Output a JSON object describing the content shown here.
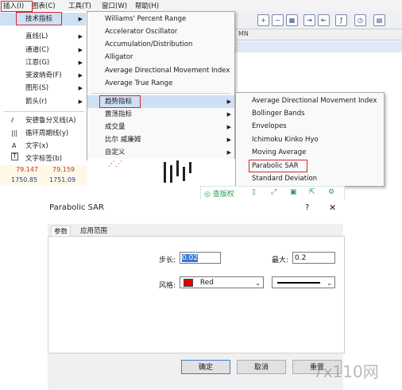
{
  "menubar": {
    "items": [
      "插入(I)",
      "图表(C)",
      "工具(T)",
      "窗口(W)",
      "帮助(H)"
    ]
  },
  "toolbar": {
    "tf_label": "MN"
  },
  "insert_menu": {
    "items": [
      {
        "label": "技术指标"
      },
      {
        "label": "直线(L)"
      },
      {
        "label": "通道(C)"
      },
      {
        "label": "江恩(G)"
      },
      {
        "label": "斐波纳奇(F)"
      },
      {
        "label": "图形(S)"
      },
      {
        "label": "箭头(r)"
      },
      {
        "label": "安德鲁分叉线(A)"
      },
      {
        "label": "循环周期线(y)"
      },
      {
        "label": "文字(x)"
      },
      {
        "label": "文字标签(b)"
      }
    ],
    "prices": [
      "79.147",
      "79.159",
      "1750.85",
      "1751.09"
    ]
  },
  "indicator_menu": {
    "items": [
      "Williams' Percent Range",
      "Accelerator Oscillator",
      "Accumulation/Distribution",
      "Alligator",
      "Average Directional Movement Index",
      "Average True Range",
      "趋势指标",
      "震荡指标",
      "成交量",
      "比尔 威廉姆",
      "自定义"
    ]
  },
  "trend_menu": {
    "items": [
      "Average Directional Movement Index",
      "Bollinger Bands",
      "Envelopes",
      "Ichimoku Kinko Hyo",
      "Moving Average",
      "Parabolic SAR",
      "Standard Deviation"
    ]
  },
  "float_bar": {
    "label": "查版权"
  },
  "dialog": {
    "title": "Parabolic SAR",
    "help": "?",
    "close": "✕",
    "tabs": [
      "参数",
      "应用范围"
    ],
    "step_label": "步长:",
    "step_value": "0.02",
    "max_label": "最大:",
    "max_value": "0.2",
    "style_label": "风格:",
    "color_name": "Red",
    "color_hex": "#e00000",
    "ok": "确定",
    "cancel": "取消",
    "reset": "重置"
  },
  "watermark": "7x110网"
}
